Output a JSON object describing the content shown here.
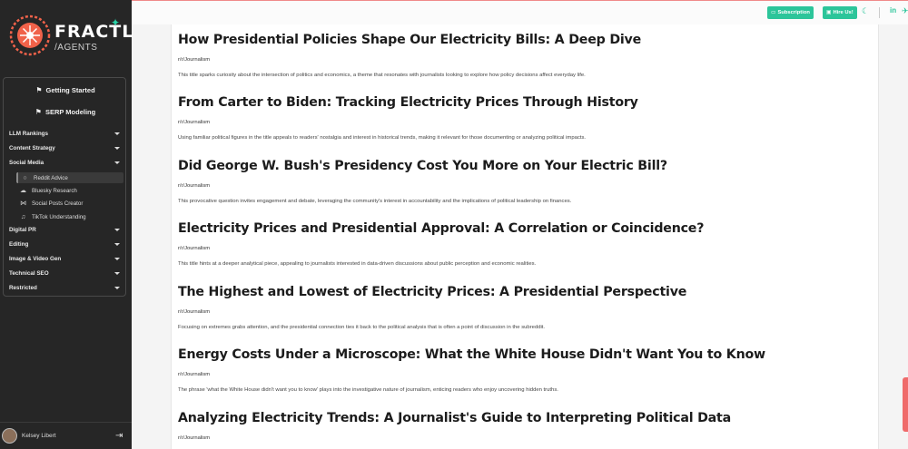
{
  "brand": {
    "name": "FRACTL",
    "sub": "/AGENTS"
  },
  "sidebar": {
    "primary": [
      {
        "label": "Getting Started",
        "icon": "flag-icon"
      },
      {
        "label": "SERP Modeling",
        "icon": "flag-icon"
      }
    ],
    "sections": [
      {
        "label": "LLM Rankings"
      },
      {
        "label": "Content Strategy"
      },
      {
        "label": "Social Media"
      },
      {
        "label": "Digital PR"
      },
      {
        "label": "Editing"
      },
      {
        "label": "Image & Video Gen"
      },
      {
        "label": "Technical SEO"
      },
      {
        "label": "Restricted"
      }
    ],
    "social_items": [
      {
        "label": "Reddit Advice",
        "icon": "chat-bubble-icon",
        "active": true
      },
      {
        "label": "Bluesky Research",
        "icon": "cloud-icon"
      },
      {
        "label": "Social Posts Creator",
        "icon": "share-icon"
      },
      {
        "label": "TikTok Understanding",
        "icon": "music-note-icon"
      }
    ]
  },
  "user": {
    "name": "Kelsey Libert"
  },
  "topbar": {
    "subscription_label": "Subscription",
    "hire_label": "Hire Us!"
  },
  "results": [
    {
      "title": "How Presidential Policies Shape Our Electricity Bills: A Deep Dive",
      "subreddit": "r/r/Journalism",
      "description": "This title sparks curiosity about the intersection of politics and economics, a theme that resonates with journalists looking to explore how policy decisions affect everyday life."
    },
    {
      "title": "From Carter to Biden: Tracking Electricity Prices Through History",
      "subreddit": "r/r/Journalism",
      "description": "Using familiar political figures in the title appeals to readers' nostalgia and interest in historical trends, making it relevant for those documenting or analyzing political impacts."
    },
    {
      "title": "Did George W. Bush's Presidency Cost You More on Your Electric Bill?",
      "subreddit": "r/r/Journalism",
      "description": "This provocative question invites engagement and debate, leveraging the community's interest in accountability and the implications of political leadership on finances."
    },
    {
      "title": "Electricity Prices and Presidential Approval: A Correlation or Coincidence?",
      "subreddit": "r/r/Journalism",
      "description": "This title hints at a deeper analytical piece, appealing to journalists interested in data-driven discussions about public perception and economic realities."
    },
    {
      "title": "The Highest and Lowest of Electricity Prices: A Presidential Perspective",
      "subreddit": "r/r/Journalism",
      "description": "Focusing on extremes grabs attention, and the presidential connection ties it back to the political analysis that is often a point of discussion in the subreddit."
    },
    {
      "title": "Energy Costs Under a Microscope: What the White House Didn't Want You to Know",
      "subreddit": "r/r/Journalism",
      "description": "The phrase 'what the White House didn't want you to know' plays into the investigative nature of journalism, enticing readers who enjoy uncovering hidden truths."
    },
    {
      "title": "Analyzing Electricity Trends: A Journalist's Guide to Interpreting Political Data",
      "subreddit": "r/r/Journalism",
      "description": ""
    }
  ],
  "colors": {
    "accent": "#2cc59a",
    "sidebar_bg": "#262626",
    "top_border": "#f08a8a"
  }
}
